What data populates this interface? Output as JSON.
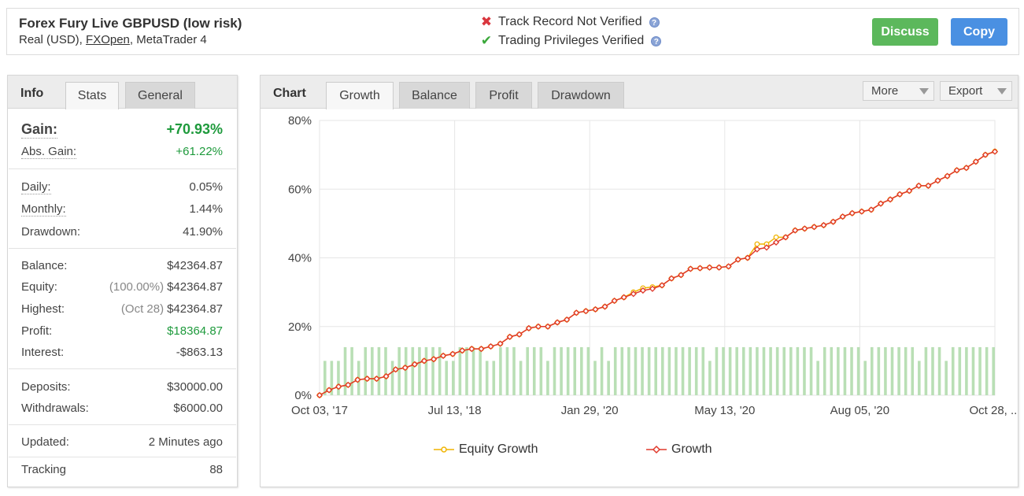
{
  "header": {
    "title": "Forex Fury Live GBPUSD (low risk)",
    "subtitle_prefix": "Real (USD),",
    "broker": "FXOpen",
    "subtitle_suffix": ", MetaTrader 4",
    "status": [
      {
        "text": "Track Record Not Verified",
        "ok": false
      },
      {
        "text": "Trading Privileges Verified",
        "ok": true
      }
    ],
    "help_glyph": "?",
    "discuss_label": "Discuss",
    "copy_label": "Copy",
    "colors": {
      "discuss": "#5cb85c",
      "copy": "#4a90e2"
    }
  },
  "info": {
    "tabs": {
      "head": "Info",
      "stats": "Stats",
      "general": "General"
    },
    "gain": {
      "label": "Gain:",
      "value": "+70.93%"
    },
    "abs_gain": {
      "label": "Abs. Gain:",
      "value": "+61.22%"
    },
    "daily": {
      "label": "Daily:",
      "value": "0.05%"
    },
    "monthly": {
      "label": "Monthly:",
      "value": "1.44%"
    },
    "drawdown": {
      "label": "Drawdown:",
      "value": "41.90%"
    },
    "balance": {
      "label": "Balance:",
      "value": "$42364.87"
    },
    "equity": {
      "label": "Equity:",
      "paren": "(100.00%)",
      "value": "$42364.87"
    },
    "highest": {
      "label": "Highest:",
      "paren": "(Oct 28)",
      "value": "$42364.87"
    },
    "profit": {
      "label": "Profit:",
      "value": "$18364.87"
    },
    "interest": {
      "label": "Interest:",
      "value": "-$863.13"
    },
    "deposits": {
      "label": "Deposits:",
      "value": "$30000.00"
    },
    "withdrawals": {
      "label": "Withdrawals:",
      "value": "$6000.00"
    },
    "updated": {
      "label": "Updated:",
      "value": "2 Minutes ago"
    },
    "tracking": {
      "label": "Tracking",
      "value": "88"
    }
  },
  "chart_panel": {
    "head": "Chart",
    "tabs": [
      "Growth",
      "Balance",
      "Profit",
      "Drawdown"
    ],
    "active_tab": "Growth",
    "more_label": "More",
    "export_label": "Export"
  },
  "chart_data": {
    "type": "line",
    "y_axis": {
      "min": 0,
      "max": 80,
      "ticks": [
        "0%",
        "20%",
        "40%",
        "60%",
        "80%"
      ]
    },
    "x_ticks": [
      "Oct 03, '17",
      "Jul 13, '18",
      "Jan 29, '20",
      "May 13, '20",
      "Aug 05, '20",
      "Oct 28, ..."
    ],
    "grid": true,
    "legend_position": "bottom",
    "series": [
      {
        "name": "Equity Growth",
        "color": "#f0b400",
        "marker": "circle",
        "values": [
          0,
          1.5,
          2.5,
          3,
          4.5,
          4.8,
          4.8,
          5.5,
          7.5,
          8,
          9,
          10,
          10.5,
          11.5,
          12,
          13,
          13.5,
          13.5,
          14.2,
          15,
          17,
          17.7,
          19.5,
          20,
          20,
          21.2,
          22,
          24,
          24.5,
          25,
          25.8,
          27.5,
          28.5,
          30,
          31.2,
          31.5,
          32,
          34,
          35,
          36.8,
          37,
          37.2,
          37.2,
          37.5,
          39.5,
          40,
          44,
          44,
          46,
          46,
          48,
          48.5,
          49,
          49.5,
          50.5,
          52,
          53,
          53.5,
          54,
          55.8,
          57,
          58.5,
          59.5,
          61,
          61,
          62.5,
          63.8,
          65.5,
          66.2,
          68,
          70,
          71
        ]
      },
      {
        "name": "Growth",
        "color": "#e0392b",
        "marker": "diamond",
        "values": [
          0,
          1.5,
          2.5,
          3,
          4.5,
          4.8,
          4.8,
          5.5,
          7.5,
          8,
          9,
          10,
          10.5,
          11.5,
          12,
          13,
          13.5,
          13.5,
          14.2,
          15,
          17,
          17.7,
          19.5,
          20,
          20,
          21.2,
          22,
          24,
          24.5,
          25,
          25.8,
          27.5,
          28.5,
          29.5,
          30.5,
          31,
          32,
          34,
          35,
          36.8,
          37,
          37.2,
          37.2,
          37.5,
          39.5,
          40,
          42.5,
          43,
          44.5,
          46,
          48,
          48.5,
          49,
          49.5,
          50.5,
          52,
          53,
          53.5,
          54,
          55.8,
          57,
          58.5,
          59.5,
          61,
          61,
          62.5,
          63.8,
          65.5,
          66.2,
          68,
          70,
          70.93
        ]
      },
      {
        "name": "",
        "type": "bar",
        "color": "#b9dfb5",
        "values": [
          10,
          10,
          10,
          14,
          14,
          10,
          14,
          14,
          14,
          14,
          10,
          14,
          14,
          14,
          14,
          14,
          14,
          14,
          10,
          10,
          14,
          14,
          14,
          14,
          10,
          10,
          14,
          14,
          14,
          10,
          14,
          14,
          14,
          10,
          14,
          14,
          14,
          14,
          14,
          14,
          10,
          14,
          10,
          14,
          14,
          14,
          14,
          14,
          14,
          14,
          14,
          14,
          14,
          14,
          14,
          14,
          14,
          10,
          14,
          14,
          14,
          14,
          14,
          14,
          14,
          14,
          14,
          14,
          14,
          14,
          14,
          14,
          14,
          10,
          14,
          14,
          14,
          14,
          14,
          14,
          10,
          14,
          14,
          14,
          14,
          14,
          14,
          14,
          10,
          14,
          14,
          14,
          10,
          14,
          14,
          14,
          14,
          14,
          14,
          14
        ]
      }
    ]
  }
}
